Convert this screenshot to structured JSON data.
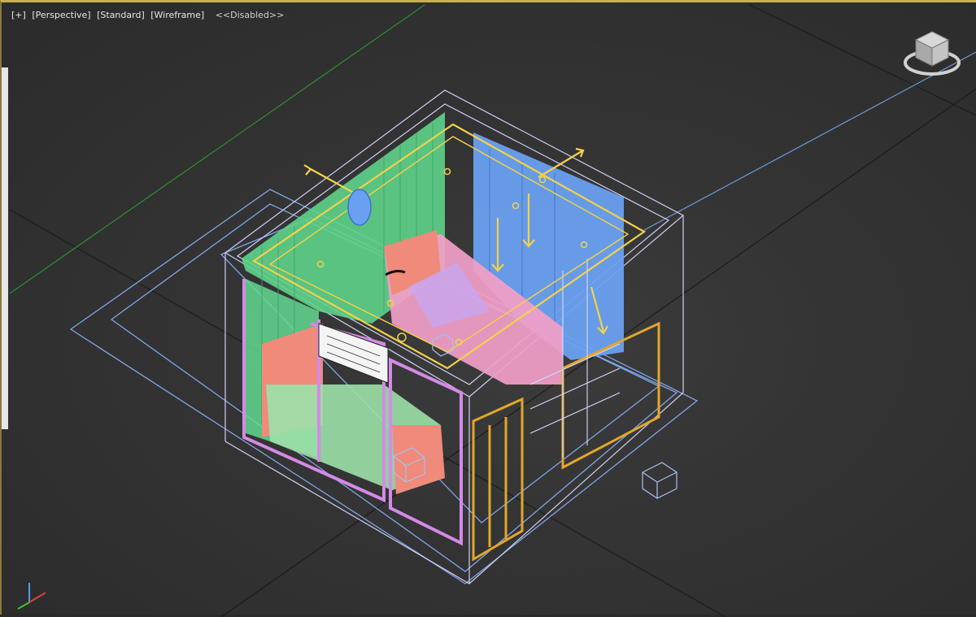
{
  "viewport": {
    "label_menu": "[+]",
    "label_view": "[Perspective]",
    "label_shading_mode": "[Standard]",
    "label_display_mode": "[Wireframe]",
    "label_status": "<<Disabled>>"
  },
  "gizmos": {
    "viewcube_icon": "viewcube-icon",
    "axis_icon": "axis-tripod-icon"
  },
  "colors": {
    "background": "#343434",
    "grid_line": "#1a1a1a",
    "x_axis": "#2f8f2f",
    "selection_outline": "#8fa8e8",
    "wireframe_white": "#d8d8ff",
    "light_yellow": "#f2d24a",
    "wall_green": "#5fd38a",
    "wall_blue": "#6aa0f0",
    "furniture_pink": "#f2a0c8",
    "furniture_salmon": "#f08a7a",
    "frame_orange": "#e2a62a",
    "frame_violet": "#d090e8",
    "floor_outline": "#7fa6e6"
  }
}
